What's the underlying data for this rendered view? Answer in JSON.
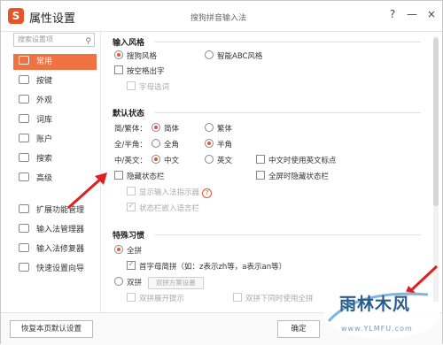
{
  "window": {
    "title": "属性设置",
    "center_title": "搜狗拼音输入法",
    "help_button": "?",
    "minimize_button": "—",
    "close_button": "×",
    "logo_letter": "S"
  },
  "sidebar": {
    "search_placeholder": "搜索设置项",
    "items": [
      {
        "label": "常用",
        "icon": "home-icon",
        "active": true
      },
      {
        "label": "按键",
        "icon": "keyboard-icon"
      },
      {
        "label": "外观",
        "icon": "palette-icon"
      },
      {
        "label": "词库",
        "icon": "book-icon"
      },
      {
        "label": "账户",
        "icon": "user-icon"
      },
      {
        "label": "搜索",
        "icon": "search-icon"
      },
      {
        "label": "高级",
        "icon": "gear-icon"
      }
    ],
    "bottom_items": [
      {
        "label": "扩展功能管理",
        "icon": "puzzle-icon"
      },
      {
        "label": "输入法管理器",
        "icon": "keyboard-icon"
      },
      {
        "label": "输入法修复器",
        "icon": "wrench-icon"
      },
      {
        "label": "快速设置向导",
        "icon": "arrow-icon"
      }
    ]
  },
  "sections": {
    "input_style": {
      "title": "输入风格",
      "opt_sogou": "搜狗风格",
      "opt_abc": "智能ABC风格",
      "space_output": "按空格出字",
      "letter_select": "字母选词"
    },
    "default_state": {
      "title": "默认状态",
      "jianfan_label": "简/繁体：",
      "jianti": "简体",
      "fanti": "繁体",
      "quanban_label": "全/半角：",
      "quanjiao": "全角",
      "banjiao": "半角",
      "zhongying_label": "中/英文：",
      "zhongwen": "中文",
      "yingwen": "英文",
      "zh_use_en_punct": "中文时使用英文标点",
      "hide_statusbar": "隐藏状态栏",
      "fullscreen_hide": "全屏时隐藏状态栏",
      "show_indicator": "显示输入法指示器",
      "statusbar_embed": "状态栏嵌入语言栏"
    },
    "special_habit": {
      "title": "特殊习惯",
      "quanpin": "全拼",
      "shouzimu": "首字母简拼（如：z表示zh等，a表示an等）",
      "shuangpin": "双拼",
      "shuangpin_setting": "双拼方案设置",
      "shuangpin_show": "双拼展开提示",
      "shuangpin_quanpin": "双拼下同时使用全拼"
    }
  },
  "footer": {
    "reset_button": "恢复本页默认设置",
    "ok_button": "确定"
  },
  "watermark": {
    "text": "雨林木风",
    "url": "www.YLMFU.com"
  },
  "colors": {
    "accent": "#e8542a",
    "arrow": "#e02020"
  }
}
